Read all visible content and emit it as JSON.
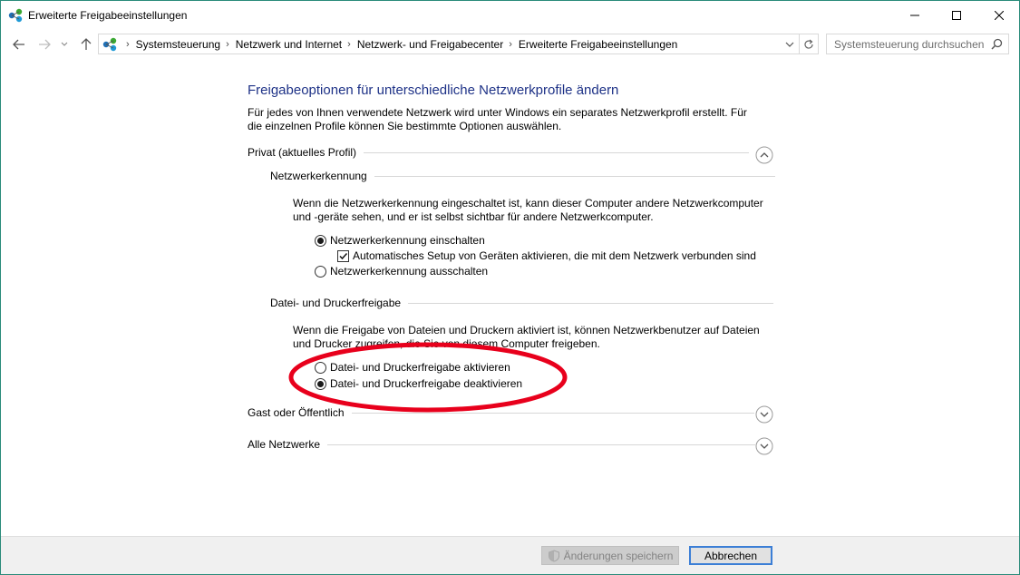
{
  "window": {
    "title": "Erweiterte Freigabeeinstellungen"
  },
  "address_bar": {
    "breadcrumbs": [
      "Systemsteuerung",
      "Netzwerk und Internet",
      "Netzwerk- und Freigabecenter",
      "Erweiterte Freigabeeinstellungen"
    ]
  },
  "search": {
    "placeholder": "Systemsteuerung durchsuchen"
  },
  "page": {
    "title": "Freigabeoptionen für unterschiedliche Netzwerkprofile ändern",
    "description": "Für jedes von Ihnen verwendete Netzwerk wird unter Windows ein separates Netzwerkprofil erstellt. Für die einzelnen Profile können Sie bestimmte Optionen auswählen."
  },
  "profiles": {
    "private": {
      "label": "Privat (aktuelles Profil)",
      "discovery": {
        "label": "Netzwerkerkennung",
        "text": "Wenn die Netzwerkerkennung eingeschaltet ist, kann dieser Computer andere Netzwerkcomputer und -geräte sehen, und er ist selbst sichtbar für andere Netzwerkcomputer.",
        "on_label": "Netzwerkerkennung einschalten",
        "auto_setup_label": "Automatisches Setup von Geräten aktivieren, die mit dem Netzwerk verbunden sind",
        "off_label": "Netzwerkerkennung ausschalten",
        "selected": "on",
        "auto_setup_checked": true
      },
      "sharing": {
        "label": "Datei- und Druckerfreigabe",
        "text": "Wenn die Freigabe von Dateien und Druckern aktiviert ist, können Netzwerkbenutzer auf Dateien und Drucker zugreifen, die Sie von diesem Computer freigeben.",
        "on_label": "Datei- und Druckerfreigabe aktivieren",
        "off_label": "Datei- und Druckerfreigabe deaktivieren",
        "selected": "off"
      }
    },
    "guest": {
      "label": "Gast oder Öffentlich"
    },
    "all": {
      "label": "Alle Netzwerke"
    }
  },
  "footer": {
    "save_label": "Änderungen speichern",
    "cancel_label": "Abbrechen"
  },
  "colors": {
    "title_blue": "#1e3287",
    "highlight_ring": "#e8001c",
    "window_border": "#2a8b7a",
    "focus_blue": "#3c7fd6"
  },
  "icons": [
    "network-icon",
    "back-arrow-icon",
    "forward-arrow-icon",
    "recent-dropdown-icon",
    "up-arrow-icon",
    "refresh-icon",
    "search-icon",
    "chevron-up-icon",
    "chevron-down-icon",
    "checkmark-icon",
    "uac-shield-icon"
  ]
}
